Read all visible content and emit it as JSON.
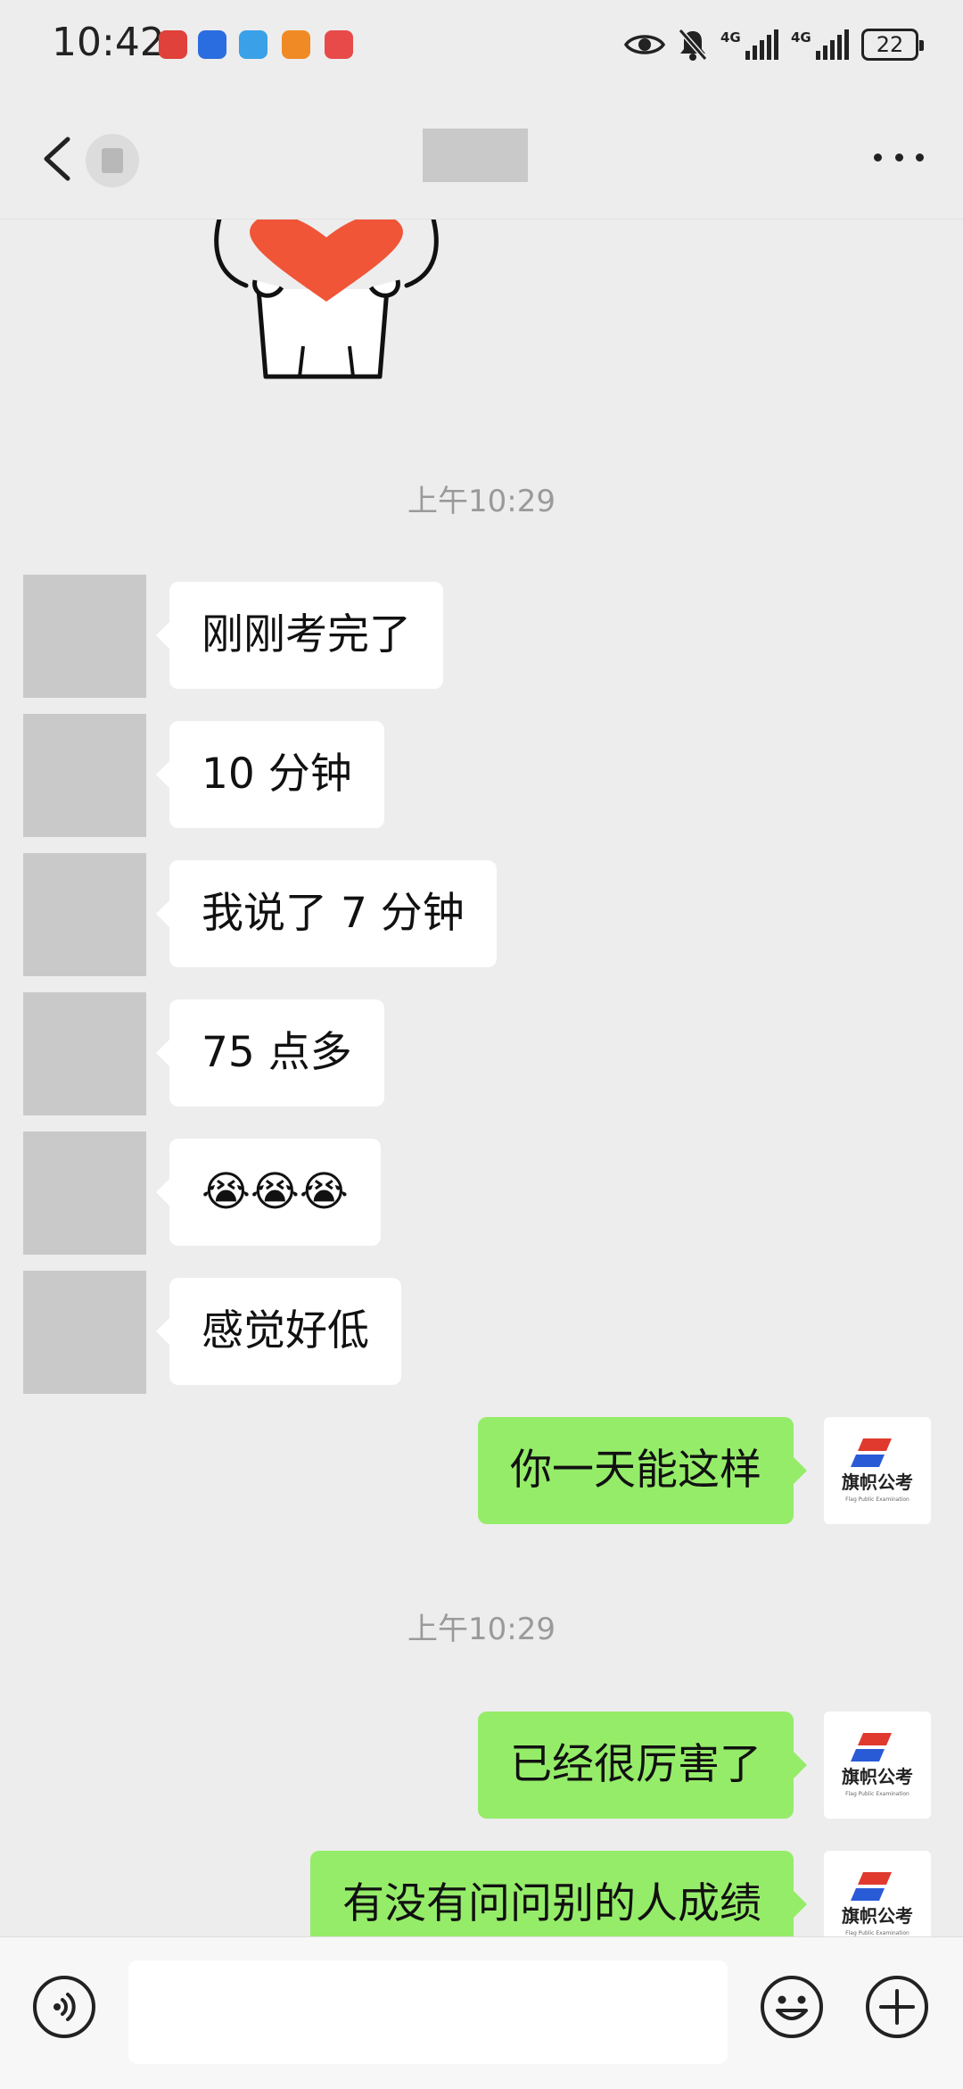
{
  "status_bar": {
    "time": "10:42",
    "network1": "4G",
    "network2": "4G",
    "battery": "22",
    "app_icons": [
      {
        "name": "huawei-app-icon",
        "color": "#e0413a"
      },
      {
        "name": "bulb-app-icon",
        "color": "#2a6de0"
      },
      {
        "name": "browser-app-icon",
        "color": "#3aa0e8"
      },
      {
        "name": "video-app-icon",
        "color": "#f08a24"
      },
      {
        "name": "book-app-icon",
        "color": "#e84a4a"
      }
    ]
  },
  "chat": {
    "messages": [
      {
        "type": "timestamp",
        "text": "上午10:29"
      },
      {
        "type": "in",
        "text": "刚刚考完了"
      },
      {
        "type": "in",
        "text": "10 分钟"
      },
      {
        "type": "in",
        "text": "我说了 7 分钟"
      },
      {
        "type": "in",
        "text": "75 点多"
      },
      {
        "type": "in",
        "text": "😭😭😭"
      },
      {
        "type": "in",
        "text": "感觉好低"
      },
      {
        "type": "out",
        "text": "你一天能这样"
      },
      {
        "type": "timestamp",
        "text": "上午10:29"
      },
      {
        "type": "out",
        "text": "已经很厉害了"
      },
      {
        "type": "out",
        "text": "有没有问问别的人成绩"
      }
    ]
  },
  "sender_logo": {
    "text": "旗帜公考",
    "subtext": "Flag Public Examination"
  },
  "colors": {
    "background": "#ededed",
    "outgoing_bubble": "#95ec69",
    "incoming_bubble": "#ffffff",
    "timestamp_text": "#9a9a9a"
  }
}
